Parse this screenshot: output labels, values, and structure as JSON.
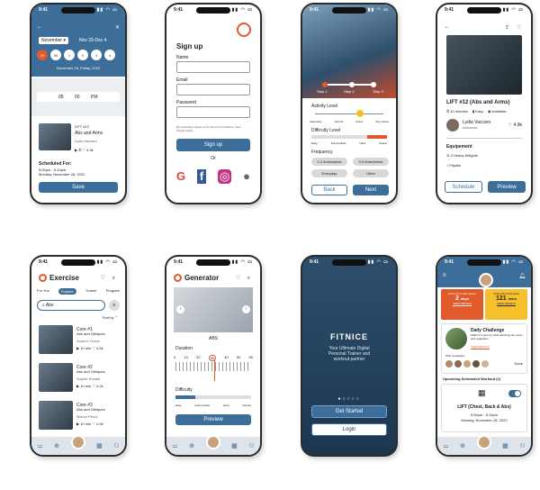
{
  "status_time": "9:41",
  "p1": {
    "month": "November",
    "range": "Nov 29-Dec 4",
    "days": [
      "29",
      "30",
      "1",
      "2",
      "3",
      "4"
    ],
    "date_label": "November 29, Friday, 2022",
    "time": {
      "h": "05",
      "m": "00",
      "ampm": "PM"
    },
    "workout": {
      "title": "LIFT #12",
      "subtitle": "Abs and Arms",
      "trainer": "Lydia Vaccaro",
      "likes": "4.9k"
    },
    "scheduled_label": "Scheduled For:",
    "scheduled_time": "5:00pm - 5:10pm",
    "scheduled_date": "Monday, November 28, 2022",
    "save": "Save"
  },
  "p2": {
    "title": "Sign up",
    "name": "Name",
    "email": "Email",
    "password": "Password",
    "terms": "By continuing I agree to the Terms & Conditions. View Privacy Policy",
    "button": "Sign up",
    "or": "Or"
  },
  "p3": {
    "steps": [
      "Step 1",
      "Step 2",
      "Step 3"
    ],
    "activity_label": "Activity Level",
    "activity_opts": [
      "Sedentary",
      "Normal",
      "Active",
      "Very Active"
    ],
    "difficulty_label": "Difficulty Level",
    "difficulty_opts": [
      "Easy",
      "Intermediate",
      "Hard",
      "Insane"
    ],
    "frequency_label": "Frequency",
    "freq": [
      "1-2 times/week",
      "3-5 times/week",
      "Everyday",
      "Other"
    ],
    "back": "Back",
    "next": "Next"
  },
  "p4": {
    "title": "LIFT #12 (Abs and Arms)",
    "duration": "10 minutes",
    "level": "Easy",
    "availability": "Available",
    "trainer": "Lydia Vaccaro",
    "role": "Instructor",
    "likes": "4.9k",
    "equipment_label": "Equipement",
    "equipment": "2 Heavy Weights",
    "playlist": "Playlist",
    "schedule": "Schedule",
    "preview": "Preview"
  },
  "p5": {
    "title": "Exercise",
    "tabs": [
      "For You",
      "Explore",
      "Trainer",
      "Program"
    ],
    "search": "Abs",
    "sort": "Sort by",
    "cards": [
      {
        "title": "Core #1",
        "sub": "Abs and Obliques",
        "trainer": "Autumn Grace",
        "time": "10 min",
        "likes": "4.5k"
      },
      {
        "title": "Core #2",
        "sub": "Abs and Obliques",
        "trainer": "Sophie Ronald",
        "time": "10 min",
        "likes": "4.2k"
      },
      {
        "title": "Core #3",
        "sub": "Abs and Obliques",
        "trainer": "Marcel Perez",
        "time": "10 min",
        "likes": "4.9k"
      }
    ]
  },
  "p6": {
    "title": "Generator",
    "exercise": "ABS",
    "duration_label": "Duration",
    "ticks": [
      "0",
      "10",
      "20",
      "30",
      "40",
      "50",
      "60"
    ],
    "selected": "30",
    "difficulty_label": "Difficulty",
    "difficulty_opts": [
      "Easy",
      "Intermediate",
      "Hard",
      "Intense"
    ],
    "preview": "Preview"
  },
  "p7": {
    "brand": "FITNICE",
    "tagline": "Your Ultimate Digital Personal Trainer and workout partner",
    "start": "Get Started",
    "login": "Login"
  },
  "p8": {
    "stat1": {
      "label": "Active Time this season",
      "value": "2",
      "unit": "days",
      "link": "VIEW DETAILS"
    },
    "stat2": {
      "label": "Active Time this week",
      "value": "121",
      "unit": "mins",
      "link": "VIEW DETAILS"
    },
    "challenge_title": "Daily Challenge",
    "challenge_desc": "Walk for a journey while admiring the views and vegetation",
    "challenge_link": "VIEW DETAILS",
    "completed": "Who completed:",
    "done": "Done",
    "upcoming": "Upcoming Scheduled Workout (1)",
    "workout": "LIFT (Chest, Back & Abs)",
    "w_time": "5:00pm - 5:10pm",
    "w_date": "Monday, November 28, 2022"
  },
  "colors": {
    "primary": "#3d6e9a",
    "accent_orange": "#e05a2b",
    "accent_yellow": "#f5c02c"
  }
}
